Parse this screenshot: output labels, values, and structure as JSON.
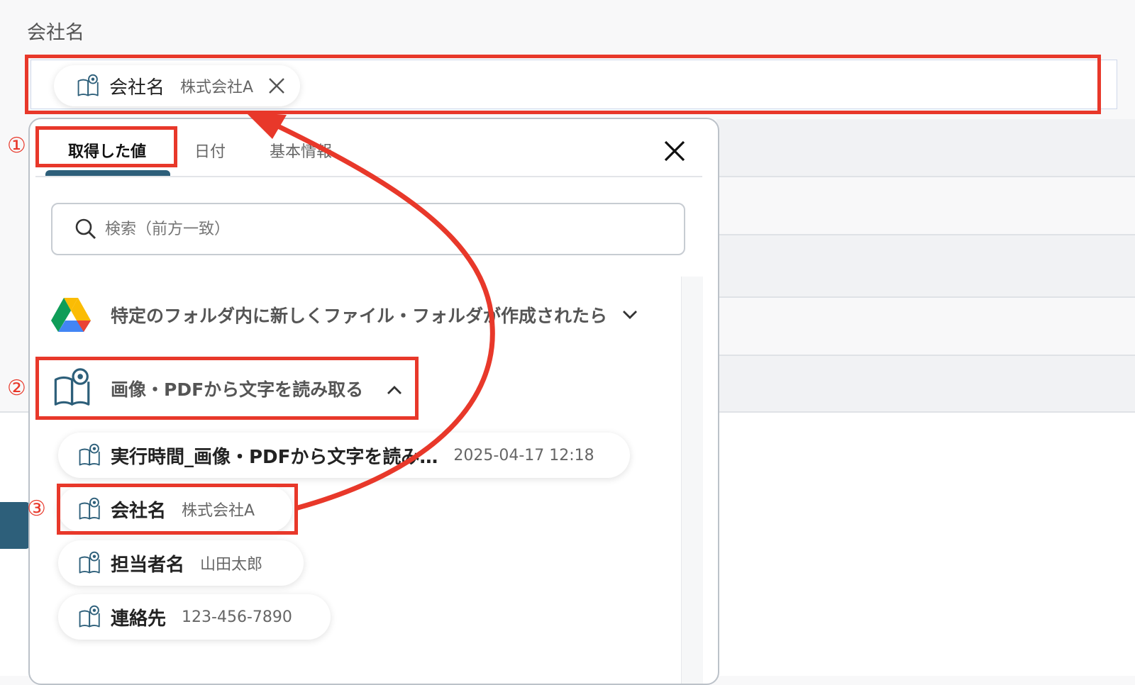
{
  "field": {
    "label": "会社名",
    "selected_chip": {
      "name": "会社名",
      "value": "株式会社A"
    }
  },
  "panel": {
    "tabs": [
      {
        "label": "取得した値",
        "active": true
      },
      {
        "label": "日付",
        "active": false
      },
      {
        "label": "基本情報",
        "active": false
      }
    ],
    "search_placeholder": "検索（前方一致）",
    "groups": [
      {
        "title": "特定のフォルダ内に新しくファイル・フォルダが作成されたら",
        "icon": "google-drive-icon",
        "expanded": false
      },
      {
        "title": "画像・PDFから文字を読み取る",
        "icon": "ocr-book-icon",
        "expanded": true
      }
    ],
    "items": [
      {
        "name": "実行時間_画像・PDFから文字を読み…",
        "value": "2025-04-17 12:18"
      },
      {
        "name": "会社名",
        "value": "株式会社A"
      },
      {
        "name": "担当者名",
        "value": "山田太郎"
      },
      {
        "name": "連絡先",
        "value": "123-456-7890"
      }
    ]
  },
  "annotations": {
    "step1": "①",
    "step2": "②",
    "step3": "③"
  },
  "colors": {
    "highlight": "#e8382a",
    "accent": "#2d5f7a",
    "icon": "#2d5f7a"
  }
}
